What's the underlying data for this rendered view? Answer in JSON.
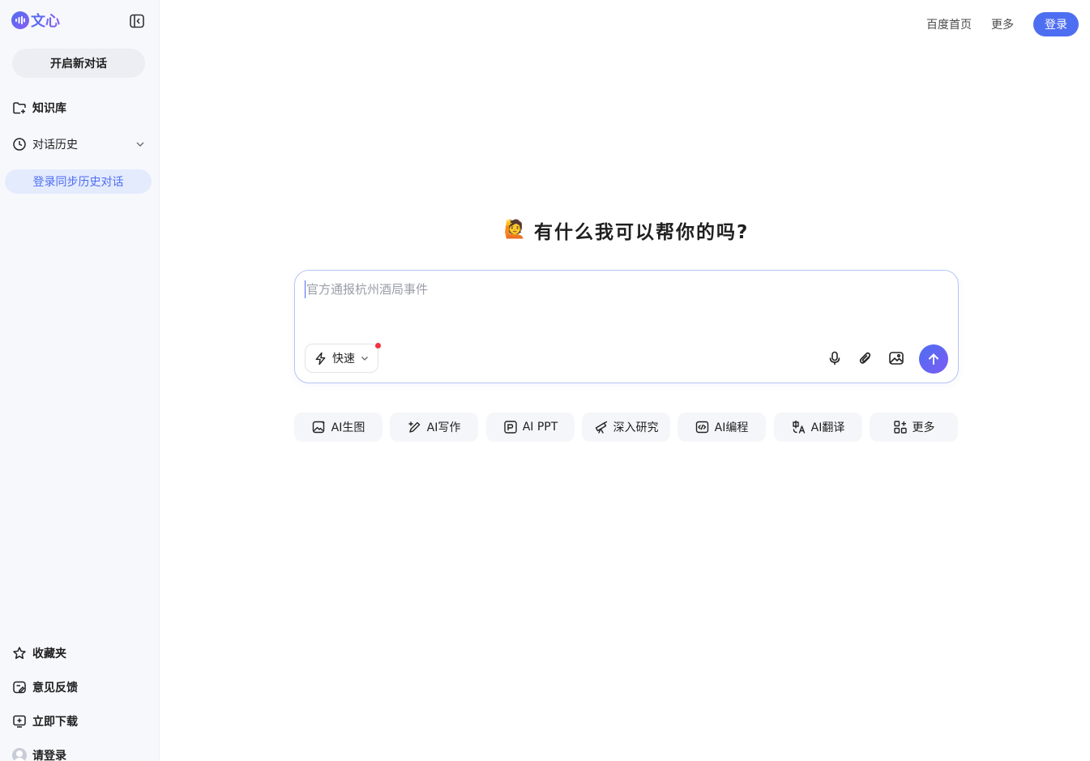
{
  "brand": {
    "name": "文心"
  },
  "sidebar": {
    "new_chat_label": "开启新对话",
    "knowledge_label": "知识库",
    "history_label": "对话历史",
    "sync_login_label": "登录同步历史对话",
    "favorites_label": "收藏夹",
    "feedback_label": "意见反馈",
    "download_label": "立即下载",
    "login_label": "请登录"
  },
  "topbar": {
    "baidu_home": "百度首页",
    "more": "更多",
    "login": "登录"
  },
  "main": {
    "greeting_emoji": "🙋",
    "greeting": "有什么我可以帮你的吗?",
    "input_placeholder": "官方通报杭州酒局事件",
    "mode_label": "快速",
    "skills": [
      {
        "label": "AI生图",
        "icon": "image-gen-icon"
      },
      {
        "label": "AI写作",
        "icon": "pen-icon"
      },
      {
        "label": "AI PPT",
        "icon": "ppt-icon"
      },
      {
        "label": "深入研究",
        "icon": "telescope-icon"
      },
      {
        "label": "AI编程",
        "icon": "code-icon"
      },
      {
        "label": "AI翻译",
        "icon": "translate-icon"
      },
      {
        "label": "更多",
        "icon": "grid-icon"
      }
    ]
  },
  "colors": {
    "accent": "#4e6ef2",
    "sidebar_bg": "#f7f8fc",
    "notification_dot": "#f5333f"
  }
}
